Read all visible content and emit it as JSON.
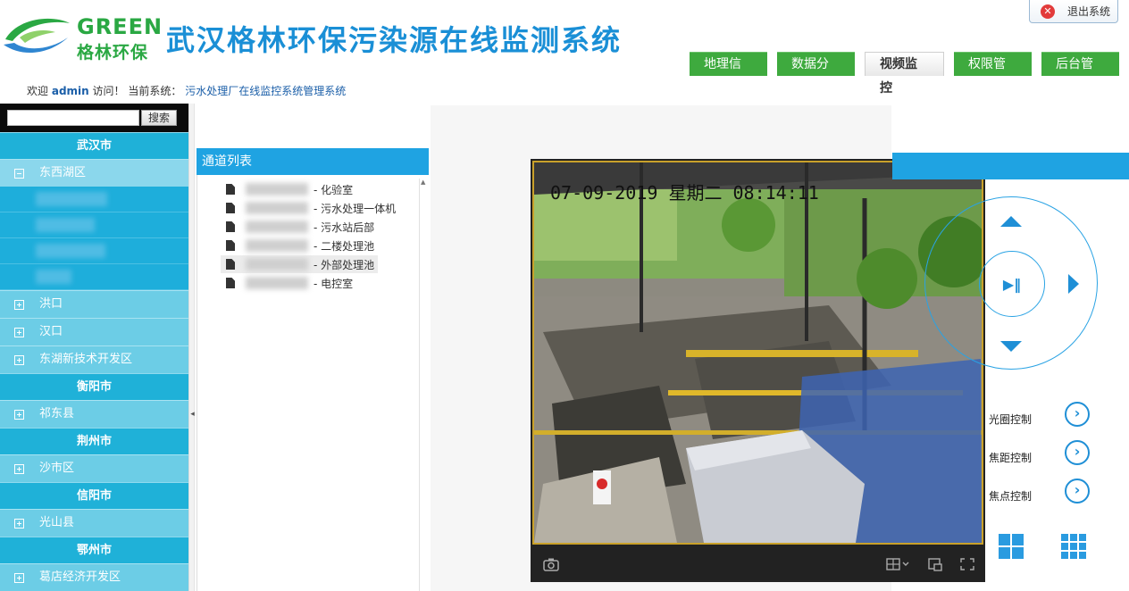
{
  "brand": {
    "en": "GREEN",
    "cn": "格林环保"
  },
  "header": {
    "title": "武汉格林环保污染源在线监测系统",
    "logout_label": "退出系统"
  },
  "nav": [
    {
      "label": "地理信息",
      "active": false
    },
    {
      "label": "数据分析",
      "active": false
    },
    {
      "label": "视频监控",
      "active": true
    },
    {
      "label": "权限管理",
      "active": false
    },
    {
      "label": "后台管理",
      "active": false
    }
  ],
  "welcome": {
    "prefix": "欢迎",
    "user": "admin",
    "middle": "访问！ 当前系统：",
    "system": "污水处理厂在线监控系统管理系统"
  },
  "sidebar": {
    "search_placeholder": "",
    "search_label": "搜索",
    "groups": [
      {
        "city": "武汉市",
        "districts": [
          "东西湖区",
          "洪口",
          "汉口",
          "东湖新技术开发区"
        ]
      },
      {
        "city": "衡阳市",
        "districts": [
          "祁东县"
        ]
      },
      {
        "city": "荆州市",
        "districts": [
          "沙市区"
        ]
      },
      {
        "city": "信阳市",
        "districts": [
          "光山县"
        ]
      },
      {
        "city": "鄂州市",
        "districts": [
          "葛店经济开发区"
        ]
      }
    ]
  },
  "channels": {
    "title": "通道列表",
    "items": [
      {
        "label": "- 化验室"
      },
      {
        "label": "- 污水处理一体机"
      },
      {
        "label": "- 污水站后部"
      },
      {
        "label": "- 二楼处理池"
      },
      {
        "label": "- 外部处理池",
        "selected": true
      },
      {
        "label": "- 电控室"
      }
    ]
  },
  "video": {
    "osd_date": "07-09-2019",
    "osd_day": "星期二",
    "osd_time": "08:14:11"
  },
  "ptz": {
    "iris_label": "光圈控制",
    "zoom_label": "焦距控制",
    "focus_label": "焦点控制"
  },
  "colors": {
    "accent_blue": "#1fa3e2",
    "nav_green": "#3eaa3e",
    "sidebar_city": "#1fb1d8",
    "sidebar_district": "#6ccde6"
  }
}
